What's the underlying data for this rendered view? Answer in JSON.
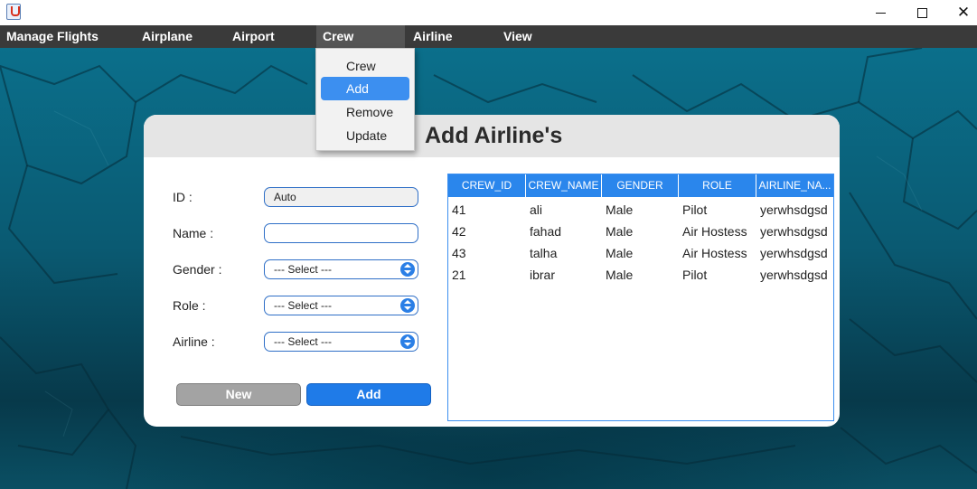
{
  "window": {
    "controls": {
      "minimize_icon": "minimize-icon",
      "maximize_icon": "maximize-icon",
      "close_glyph": "✕"
    }
  },
  "menubar": {
    "items": [
      {
        "label": "Manage Flights"
      },
      {
        "label": "Airplane"
      },
      {
        "label": "Airport"
      },
      {
        "label": "Crew",
        "active": true
      },
      {
        "label": "Airline"
      },
      {
        "label": "View"
      }
    ]
  },
  "crew_menu": {
    "items": [
      {
        "label": "Crew"
      },
      {
        "label": "Add",
        "selected": true
      },
      {
        "label": "Remove"
      },
      {
        "label": "Update"
      }
    ]
  },
  "form": {
    "title": "Add Airline's",
    "id_label": "ID :",
    "id_value": "Auto",
    "name_label": "Name :",
    "name_value": "",
    "gender_label": "Gender :",
    "gender_value": "--- Select ---",
    "role_label": "Role :",
    "role_value": "--- Select ---",
    "airline_label": "Airline :",
    "airline_value": "--- Select ---",
    "new_button": "New",
    "add_button": "Add"
  },
  "table": {
    "columns": [
      "CREW_ID",
      "CREW_NAME",
      "GENDER",
      "ROLE",
      "AIRLINE_NA..."
    ],
    "rows": [
      [
        "41",
        "ali",
        "Male",
        "Pilot",
        "yerwhsdgsd"
      ],
      [
        "42",
        "fahad",
        "Male",
        "Air Hostess",
        "yerwhsdgsd"
      ],
      [
        "43",
        "talha",
        "Male",
        "Air Hostess",
        "yerwhsdgsd"
      ],
      [
        "21",
        "ibrar",
        "Male",
        "Pilot",
        "yerwhsdgsd"
      ]
    ]
  },
  "colors": {
    "menubar": "#3a3a3a",
    "accent": "#2a86ec",
    "new_button": "#a3a3a3"
  }
}
